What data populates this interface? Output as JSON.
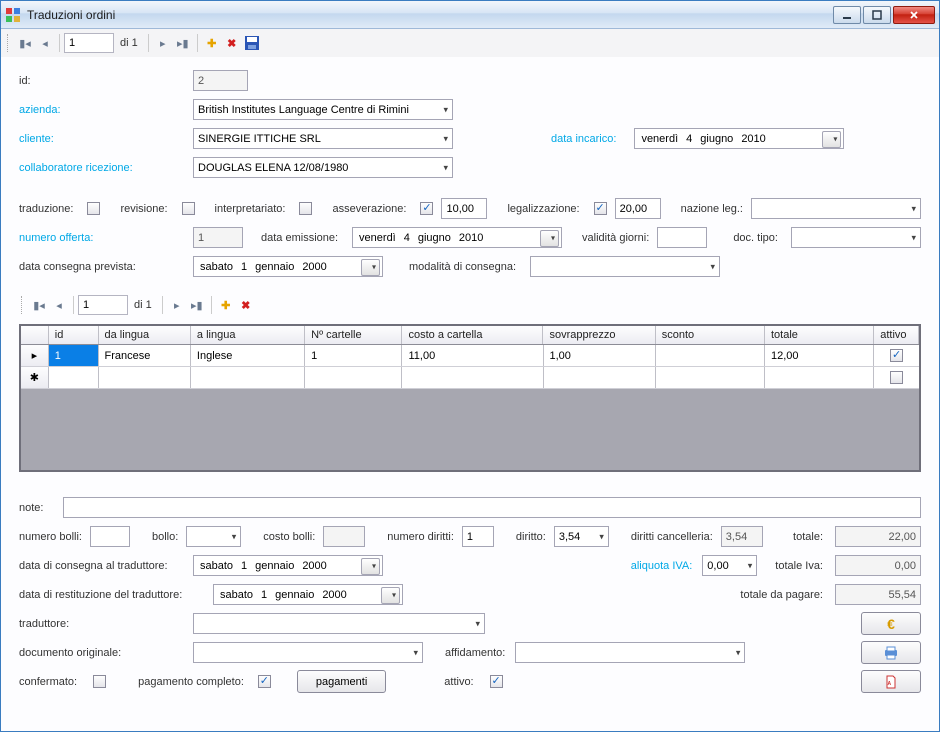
{
  "window": {
    "title": "Traduzioni ordini"
  },
  "nav1": {
    "pos": "1",
    "of_label": "di 1"
  },
  "nav2": {
    "pos": "1",
    "of_label": "di 1"
  },
  "form": {
    "id_label": "id:",
    "id_value": "2",
    "azienda_label": "azienda:",
    "azienda_value": "British Institutes Language Centre di Rimini",
    "cliente_label": "cliente:",
    "cliente_value": "SINERGIE ITTICHE SRL",
    "data_incarico_label": "data incarico:",
    "data_incarico": {
      "dow": "venerdì",
      "d": "4",
      "m": "giugno",
      "y": "2010"
    },
    "collab_label": "collaboratore ricezione:",
    "collab_value": "DOUGLAS ELENA 12/08/1980",
    "traduzione_label": "traduzione:",
    "revisione_label": "revisione:",
    "interpretariato_label": "interpretariato:",
    "asseverazione_label": "asseverazione:",
    "asseverazione_val": "10,00",
    "legalizzazione_label": "legalizzazione:",
    "legalizzazione_val": "20,00",
    "nazione_leg_label": "nazione leg.:",
    "numero_offerta_label": "numero offerta:",
    "numero_offerta_val": "1",
    "data_emissione_label": "data emissione:",
    "data_emissione": {
      "dow": "venerdì",
      "d": "4",
      "m": "giugno",
      "y": "2010"
    },
    "validita_label": "validità giorni:",
    "doc_tipo_label": "doc. tipo:",
    "data_consegna_prev_label": "data consegna prevista:",
    "data_consegna_prev": {
      "dow": "sabato",
      "d": "1",
      "m": "gennaio",
      "y": "2000"
    },
    "modalita_consegna_label": "modalità di consegna:"
  },
  "grid": {
    "headers": {
      "id": "id",
      "da_lingua": "da lingua",
      "a_lingua": "a lingua",
      "n_cartelle": "Nº cartelle",
      "costo_cartella": "costo a cartella",
      "sovrapprezzo": "sovrapprezzo",
      "sconto": "sconto",
      "totale": "totale",
      "attivo": "attivo"
    },
    "rows": [
      {
        "id": "1",
        "da_lingua": "Francese",
        "a_lingua": "Inglese",
        "n_cartelle": "1",
        "costo_cartella": "11,00",
        "sovrapprezzo": "1,00",
        "sconto": "",
        "totale": "12,00",
        "attivo": true
      }
    ]
  },
  "footer": {
    "note_label": "note:",
    "numero_bolli_label": "numero bolli:",
    "bollo_label": "bollo:",
    "costo_bolli_label": "costo bolli:",
    "numero_diritti_label": "numero diritti:",
    "numero_diritti_val": "1",
    "diritto_label": "diritto:",
    "diritto_val": "3,54",
    "diritti_cancelleria_label": "diritti cancelleria:",
    "diritti_cancelleria_val": "3,54",
    "totale_label": "totale:",
    "totale_val": "22,00",
    "data_consegna_trad_label": "data di consegna al traduttore:",
    "data_consegna_trad": {
      "dow": "sabato",
      "d": "1",
      "m": "gennaio",
      "y": "2000"
    },
    "aliquota_iva_label": "aliquota IVA:",
    "aliquota_iva_val": "0,00",
    "totale_iva_label": "totale Iva:",
    "totale_iva_val": "0,00",
    "data_restituzione_label": "data di restituzione del traduttore:",
    "data_restituzione": {
      "dow": "sabato",
      "d": "1",
      "m": "gennaio",
      "y": "2000"
    },
    "totale_pagare_label": "totale da pagare:",
    "totale_pagare_val": "55,54",
    "traduttore_label": "traduttore:",
    "documento_orig_label": "documento originale:",
    "affidamento_label": "affidamento:",
    "confermato_label": "confermato:",
    "pagamento_completo_label": "pagamento completo:",
    "pagamenti_btn": "pagamenti",
    "attivo_label": "attivo:"
  }
}
